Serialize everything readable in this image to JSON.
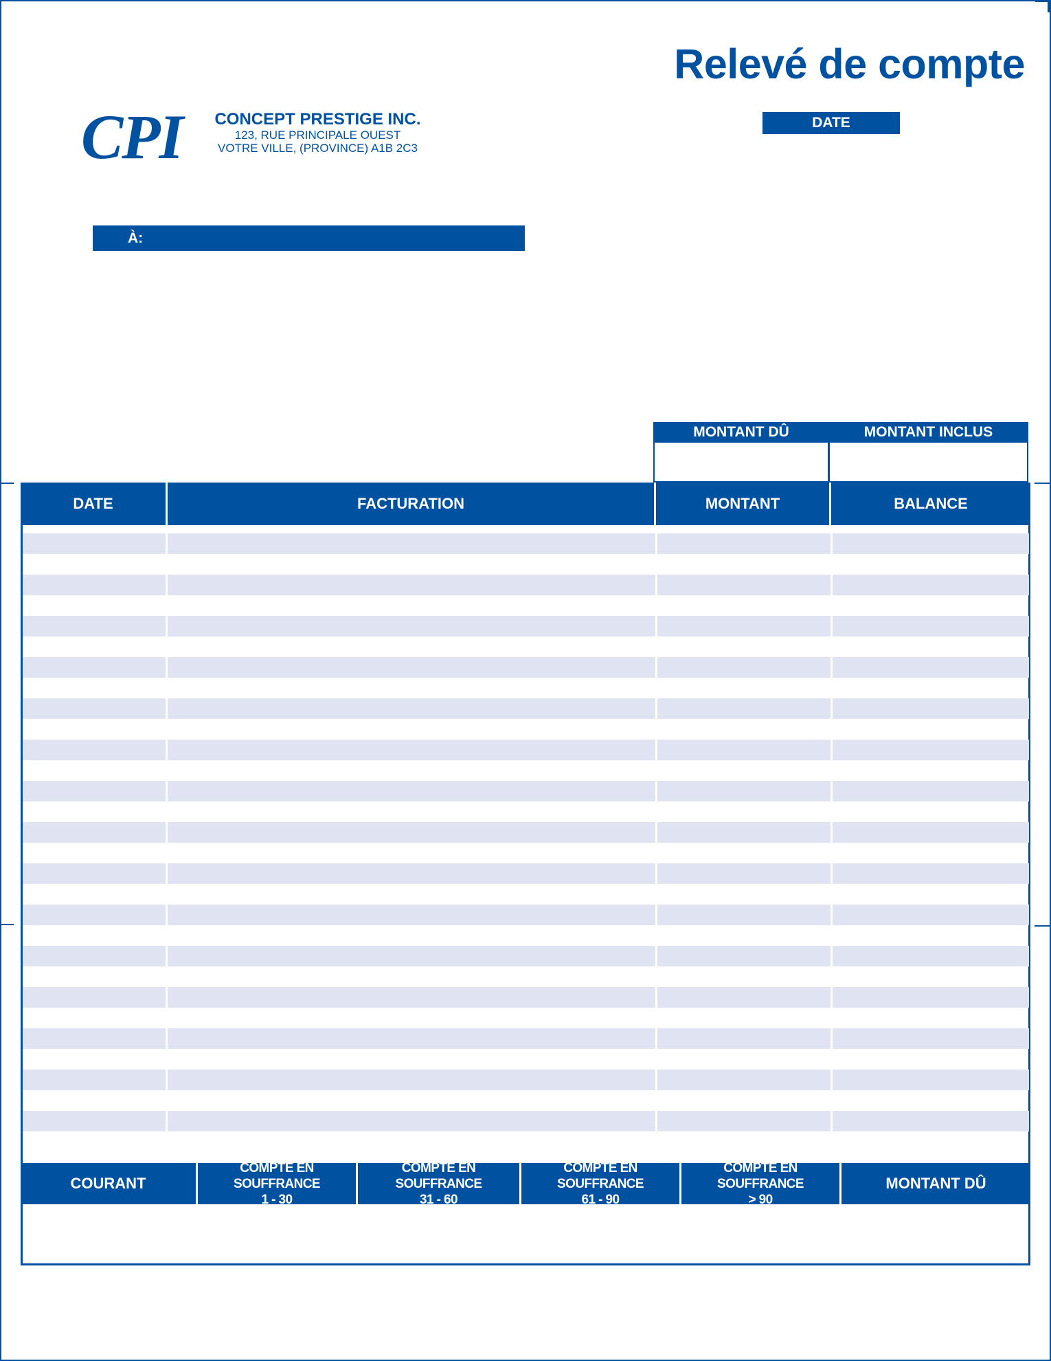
{
  "document": {
    "title": "Relevé de compte",
    "date_label": "DATE"
  },
  "company": {
    "logo": "CPI",
    "name": "CONCEPT PRESTIGE INC.",
    "address_line1": "123, RUE PRINCIPALE OUEST",
    "address_line2": "VOTRE VILLE, (PROVINCE) A1B 2C3"
  },
  "recipient": {
    "label": "À:"
  },
  "summary": {
    "amount_due_label": "MONTANT DÛ",
    "amount_included_label": "MONTANT INCLUS"
  },
  "table": {
    "columns": [
      "DATE",
      "FACTURATION",
      "MONTANT",
      "BALANCE"
    ],
    "row_count": 15
  },
  "aging": {
    "columns": [
      {
        "line1": "COURANT",
        "line2": ""
      },
      {
        "line1": "COMPTE EN SOUFFRANCE",
        "line2": "1 - 30"
      },
      {
        "line1": "COMPTE EN SOUFFRANCE",
        "line2": "31 - 60"
      },
      {
        "line1": "COMPTE EN SOUFFRANCE",
        "line2": "61 - 90"
      },
      {
        "line1": "COMPTE EN SOUFFRANCE",
        "line2": "> 90"
      },
      {
        "line1": "MONTANT DÛ",
        "line2": ""
      }
    ]
  },
  "colors": {
    "brand_blue": "#0052a1",
    "row_shade": "#dfe3f2"
  }
}
